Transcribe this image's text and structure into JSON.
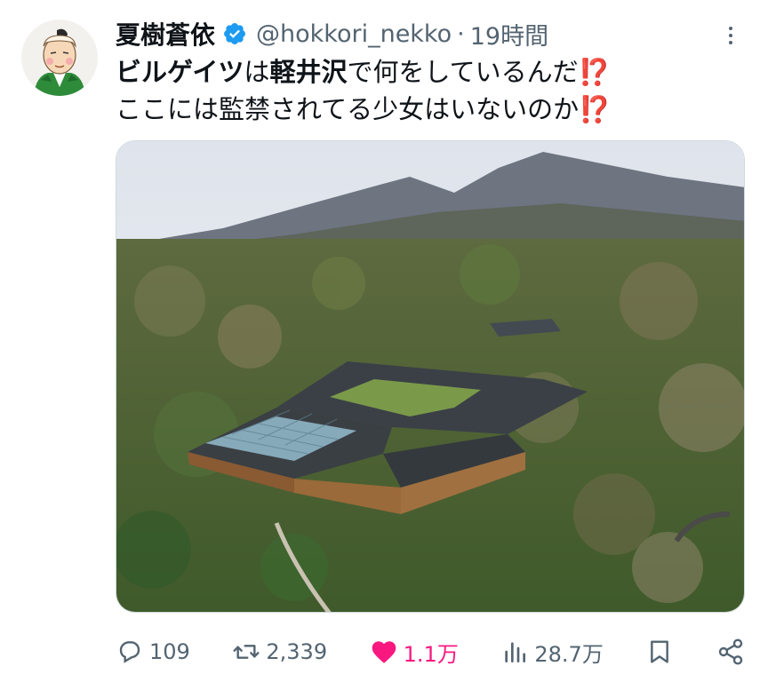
{
  "tweet": {
    "display_name": "夏樹蒼依",
    "handle": "@hokkori_nekko",
    "separator": "·",
    "time": "19時間",
    "line1_bold": "ビルゲイツ",
    "line1_text_a": "は",
    "line1_bold_b": "軽井沢",
    "line1_text_b": "で何をしているんだ",
    "line2_text": "ここには監禁されてる少女はいないのか",
    "emoji": "⁉️"
  },
  "actions": {
    "replies": "109",
    "retweets": "2,339",
    "likes": "1.1万",
    "views": "28.7万"
  },
  "icons": {
    "avatar": "samurai-avatar-icon",
    "verified": "verified-badge-icon",
    "more": "more-options-icon",
    "reply": "reply-icon",
    "retweet": "retweet-icon",
    "like": "heart-icon",
    "views": "views-icon",
    "bookmark": "bookmark-icon",
    "share": "share-icon"
  },
  "colors": {
    "like_active": "#f91880",
    "verified": "#1d9bf0",
    "secondary_text": "#536471"
  }
}
